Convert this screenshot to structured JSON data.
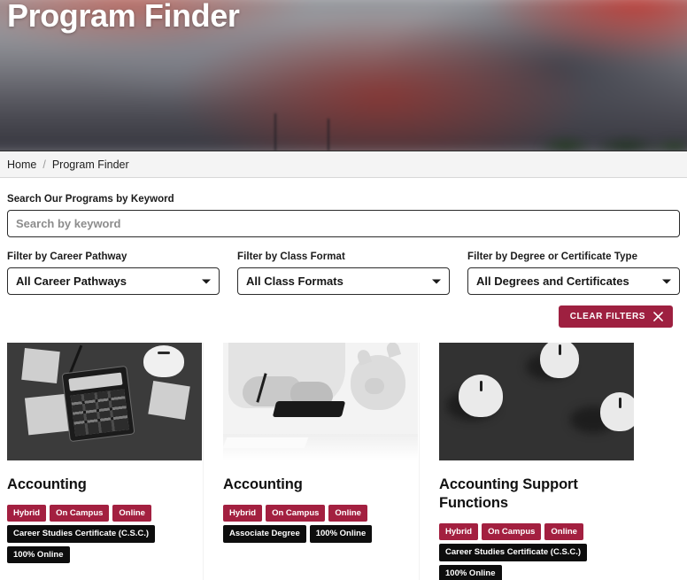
{
  "hero": {
    "title": "Program Finder"
  },
  "breadcrumb": {
    "home": "Home",
    "separator": "/",
    "current": "Program Finder"
  },
  "search": {
    "label": "Search Our Programs by Keyword",
    "placeholder": "Search by keyword",
    "value": ""
  },
  "filters": [
    {
      "label": "Filter by Career Pathway",
      "selected": "All Career Pathways",
      "icon": "chevron-down-icon"
    },
    {
      "label": "Filter by Class Format",
      "selected": "All Class Formats",
      "icon": "chevron-down-icon"
    },
    {
      "label": "Filter by Degree or Certificate Type",
      "selected": "All Degrees and Certificates",
      "icon": "chevron-down-icon"
    }
  ],
  "clear_filters": {
    "label": "CLEAR FILTERS",
    "icon": "close-x-icon",
    "color": "#9e2040"
  },
  "colors": {
    "accent_red": "#a32040",
    "tag_dark": "#0d0d0d",
    "breadcrumb_bg": "#f4f4f4"
  },
  "cards": [
    {
      "title": "Accounting",
      "image_alt": "calculator-notes-piggybank-photo",
      "formats": [
        "Hybrid",
        "On Campus",
        "Online"
      ],
      "degrees": [
        "Career Studies Certificate (C.S.C.)",
        "100% Online"
      ]
    },
    {
      "title": "Accounting",
      "image_alt": "hand-writing-calculator-piggybank-photo",
      "formats": [
        "Hybrid",
        "On Campus",
        "Online"
      ],
      "degrees": [
        "Associate Degree",
        "100% Online"
      ]
    },
    {
      "title": "Accounting Support Functions",
      "image_alt": "three-piggybanks-photo",
      "formats": [
        "Hybrid",
        "On Campus",
        "Online"
      ],
      "degrees": [
        "Career Studies Certificate (C.S.C.)",
        "100% Online"
      ]
    }
  ]
}
